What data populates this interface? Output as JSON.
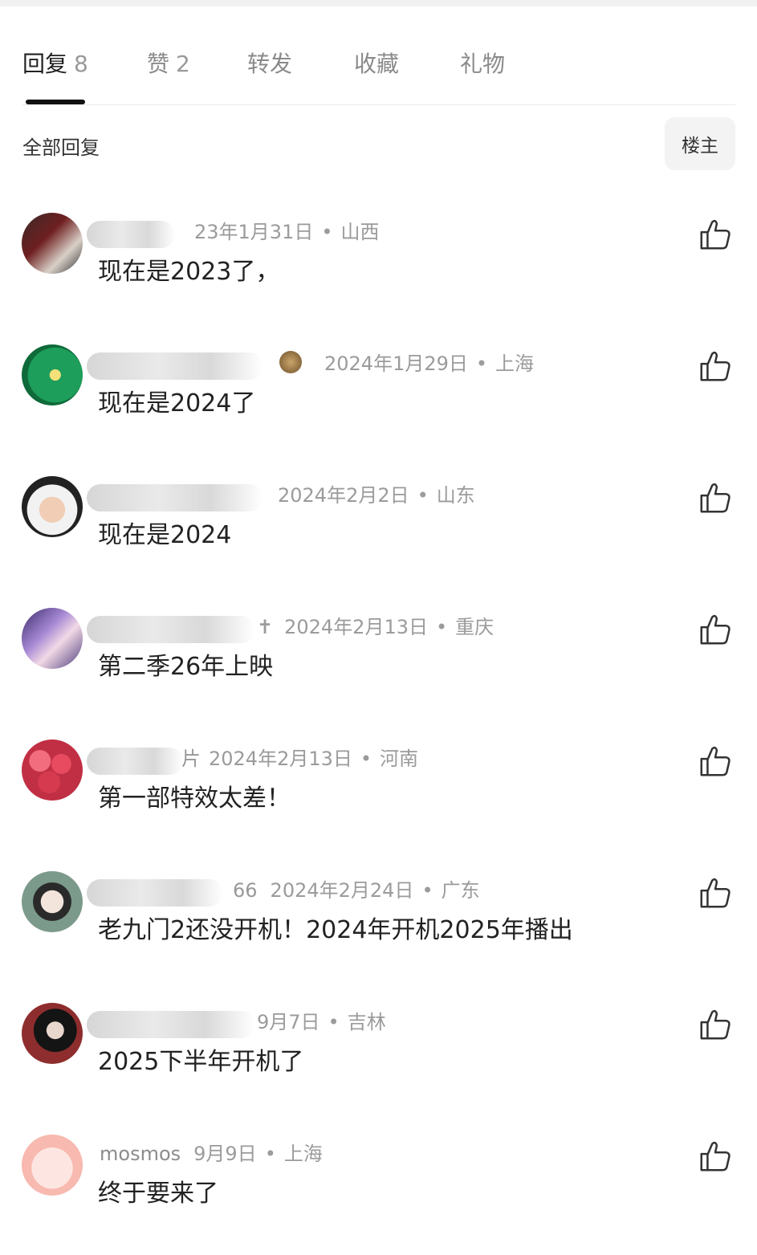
{
  "tabs": [
    {
      "label": "回复",
      "count": "8",
      "active": true
    },
    {
      "label": "赞",
      "count": "2",
      "active": false
    },
    {
      "label": "转发",
      "count": "",
      "active": false
    },
    {
      "label": "收藏",
      "count": "",
      "active": false
    },
    {
      "label": "礼物",
      "count": "",
      "active": false
    }
  ],
  "section": {
    "title": "全部回复",
    "filter": "楼主"
  },
  "comments": [
    {
      "meta_date": "23年1月31日",
      "location": "山西",
      "text": "现在是2023了，"
    },
    {
      "meta_date": "2024年1月29日",
      "location": "上海",
      "text": "现在是2024了"
    },
    {
      "meta_date": "2024年2月2日",
      "location": "山东",
      "text": "现在是2024"
    },
    {
      "meta_date": "2024年2月13日",
      "location": "重庆",
      "text": "第二季26年上映"
    },
    {
      "meta_date": "2024年2月13日",
      "location": "河南",
      "text": "第一部特效太差！"
    },
    {
      "meta_date": "2024年2月24日",
      "location": "广东",
      "text": "老九门2还没开机！2024年开机2025年播出"
    },
    {
      "meta_date": "9月7日",
      "location": "吉林",
      "text": "2025下半年开机了"
    },
    {
      "username": "mosmos",
      "meta_date": "9月9日",
      "location": "上海",
      "text": "终于要来了"
    }
  ],
  "icons": {
    "like": "thumbs-up-icon"
  },
  "colors": {
    "text": "#222222",
    "meta": "#9b9b9b",
    "underline": "#111111"
  }
}
